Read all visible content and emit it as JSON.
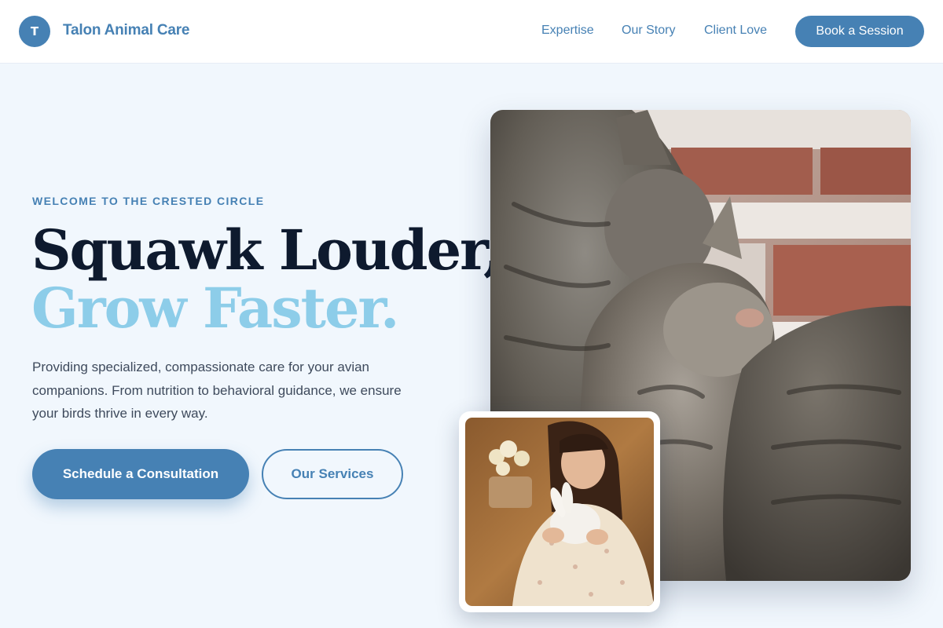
{
  "header": {
    "logo_letter": "T",
    "brand": "Talon Animal Care",
    "nav": [
      "Expertise",
      "Our Story",
      "Client Love"
    ],
    "cta": "Book a Session"
  },
  "hero": {
    "eyebrow": "WELCOME TO THE CRESTED CIRCLE",
    "headline_line1": "Squawk Louder,",
    "headline_line2": "Grow Faster.",
    "lead": "Providing specialized, compassionate care for your avian companions. From nutrition to behavioral guidance, we ensure your birds thrive in every way.",
    "primary_button": "Schedule a Consultation",
    "secondary_button": "Our Services"
  },
  "colors": {
    "brand": "#4681b4",
    "accent": "#8dcde9",
    "heading": "#0e1a2e",
    "background": "#f1f7fd"
  }
}
